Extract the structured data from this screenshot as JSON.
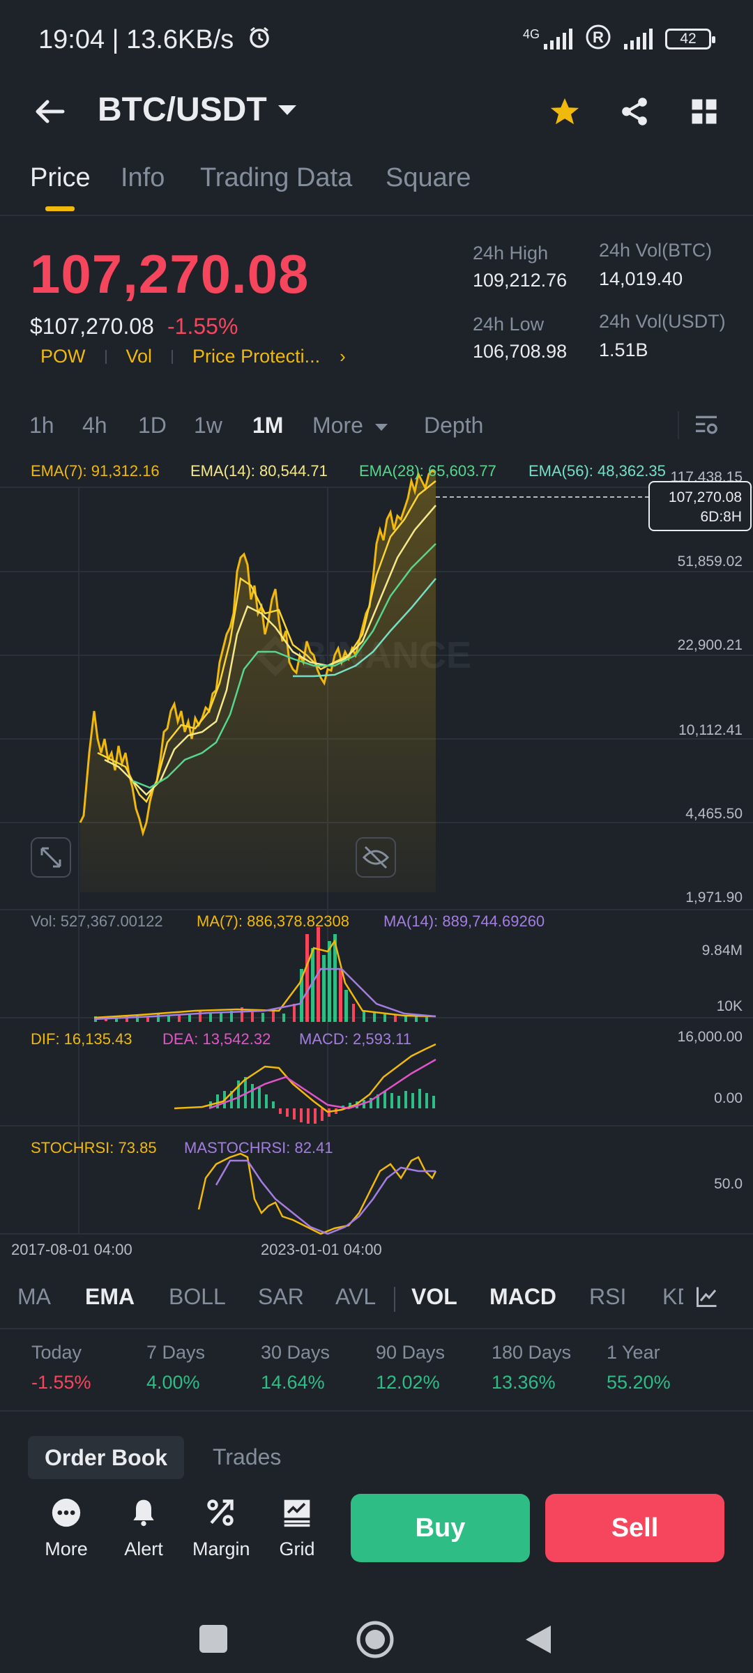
{
  "status_bar": {
    "time": "19:04 | 13.6KB/s",
    "network": "4G",
    "battery": "42"
  },
  "header": {
    "pair": "BTC/USDT"
  },
  "tabs": [
    {
      "label": "Price",
      "active": true
    },
    {
      "label": "Info",
      "active": false
    },
    {
      "label": "Trading Data",
      "active": false
    },
    {
      "label": "Square",
      "active": false
    }
  ],
  "ticker": {
    "last_price": "107,270.08",
    "usd_price": "$107,270.08",
    "change": "-1.55%",
    "tags": [
      "POW",
      "Vol",
      "Price Protecti..."
    ],
    "high_label": "24h High",
    "high_value": "109,212.76",
    "low_label": "24h Low",
    "low_value": "106,708.98",
    "vol_btc_label": "24h Vol(BTC)",
    "vol_btc_value": "14,019.40",
    "vol_usdt_label": "24h Vol(USDT)",
    "vol_usdt_value": "1.51B"
  },
  "intervals": [
    {
      "label": "1h",
      "active": false
    },
    {
      "label": "4h",
      "active": false
    },
    {
      "label": "1D",
      "active": false
    },
    {
      "label": "1w",
      "active": false
    },
    {
      "label": "1M",
      "active": true
    },
    {
      "label": "More",
      "active": false
    },
    {
      "label": "Depth",
      "active": false
    }
  ],
  "chart": {
    "ema7": "EMA(7): 91,312.16",
    "ema14": "EMA(14): 80,544.71",
    "ema28": "EMA(28): 65,603.77",
    "ema56": "EMA(56): 48,362.35",
    "price_axis": [
      "117,438.15",
      "51,859.02",
      "22,900.21",
      "10,112.41",
      "4,465.50",
      "1,971.90"
    ],
    "last_price_tag": "107,270.08",
    "countdown": "6D:8H",
    "watermark": "BINANCE",
    "vol_line": "Vol: 527,367.00122",
    "vol_ma7": "MA(7): 886,378.82308",
    "vol_ma14": "MA(14): 889,744.69260",
    "vol_axis": [
      "9.84M",
      "10K"
    ],
    "dif": "DIF: 16,135.43",
    "dea": "DEA: 13,542.32",
    "macd": "MACD: 2,593.11",
    "macd_axis": [
      "16,000.00",
      "0.00"
    ],
    "stochrsi": "STOCHRSI: 73.85",
    "mastochrsi": "MASTOCHRSI: 82.41",
    "stoch_axis": "50.0",
    "time_labels": [
      "2017-08-01 04:00",
      "2023-01-01 04:00"
    ]
  },
  "indicator_tabs": [
    {
      "label": "MA",
      "active": false
    },
    {
      "label": "EMA",
      "active": true
    },
    {
      "label": "BOLL",
      "active": false
    },
    {
      "label": "SAR",
      "active": false
    },
    {
      "label": "AVL",
      "active": false
    },
    {
      "label": "VOL",
      "active": true
    },
    {
      "label": "MACD",
      "active": true
    },
    {
      "label": "RSI",
      "active": false
    },
    {
      "label": "KD",
      "active": false
    }
  ],
  "performance": [
    {
      "label": "Today",
      "value": "-1.55%",
      "color": "#f6465d"
    },
    {
      "label": "7 Days",
      "value": "4.00%",
      "color": "#2ebd85"
    },
    {
      "label": "30 Days",
      "value": "14.64%",
      "color": "#2ebd85"
    },
    {
      "label": "90 Days",
      "value": "12.02%",
      "color": "#2ebd85"
    },
    {
      "label": "180 Days",
      "value": "13.36%",
      "color": "#2ebd85"
    },
    {
      "label": "1 Year",
      "value": "55.20%",
      "color": "#2ebd85"
    }
  ],
  "bottom_tabs": {
    "order_book": "Order Book",
    "trades": "Trades"
  },
  "actions": [
    {
      "label": "More",
      "icon": "more-icon"
    },
    {
      "label": "Alert",
      "icon": "bell-icon"
    },
    {
      "label": "Margin",
      "icon": "margin-icon"
    },
    {
      "label": "Grid",
      "icon": "grid-bot-icon"
    }
  ],
  "buy_label": "Buy",
  "sell_label": "Sell",
  "colors": {
    "background": "#1e2329",
    "accent": "#f0b90b",
    "up": "#2ebd85",
    "down": "#f6465d"
  }
}
